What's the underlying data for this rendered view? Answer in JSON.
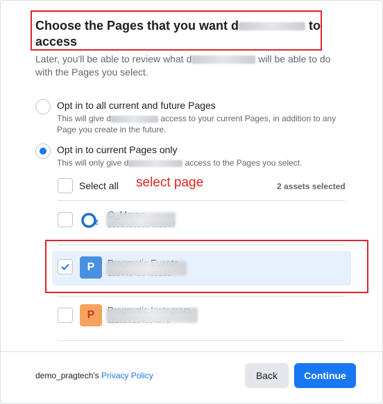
{
  "header": {
    "title_part1": "Choose the Pages that you want d",
    "title_part2": " to",
    "title_line2": "access"
  },
  "description": {
    "part1": "Later, you'll be able to review what d",
    "part2": " will be able to do",
    "line2": "with the Pages you select."
  },
  "options": [
    {
      "label": "Opt in to all current and future Pages",
      "sub_part1": "This will give d",
      "sub_part2": " access to your current Pages, in addition to any Page you create in the future.",
      "selected": false
    },
    {
      "label": "Opt in to current Pages only",
      "sub_part1": "This will only give d",
      "sub_part2": " access to the Pages you select.",
      "selected": true
    }
  ],
  "select_all": {
    "label": "Select all",
    "annotation": "select page",
    "count": "2 assets selected"
  },
  "pages": [
    {
      "name": "O_Marao",
      "id": "1508535895453847",
      "icon": "O2",
      "icon_color": "#ffffff",
      "checked": false
    },
    {
      "name": "Pragmatic Events",
      "id": "108449498489163",
      "icon": "P",
      "icon_color": "#4a90e2",
      "checked": true
    },
    {
      "name": "Pragmatic Instagram",
      "id": "111820194004070",
      "icon": "P",
      "icon_color": "#f5a25d",
      "checked": false
    }
  ],
  "footer": {
    "owner": "demo_pragtech's",
    "privacy_link": "Privacy Policy",
    "back_label": "Back",
    "continue_label": "Continue"
  },
  "colors": {
    "accent": "#1877f2",
    "highlight_box": "#d9262b",
    "annotation": "#e0251d"
  }
}
